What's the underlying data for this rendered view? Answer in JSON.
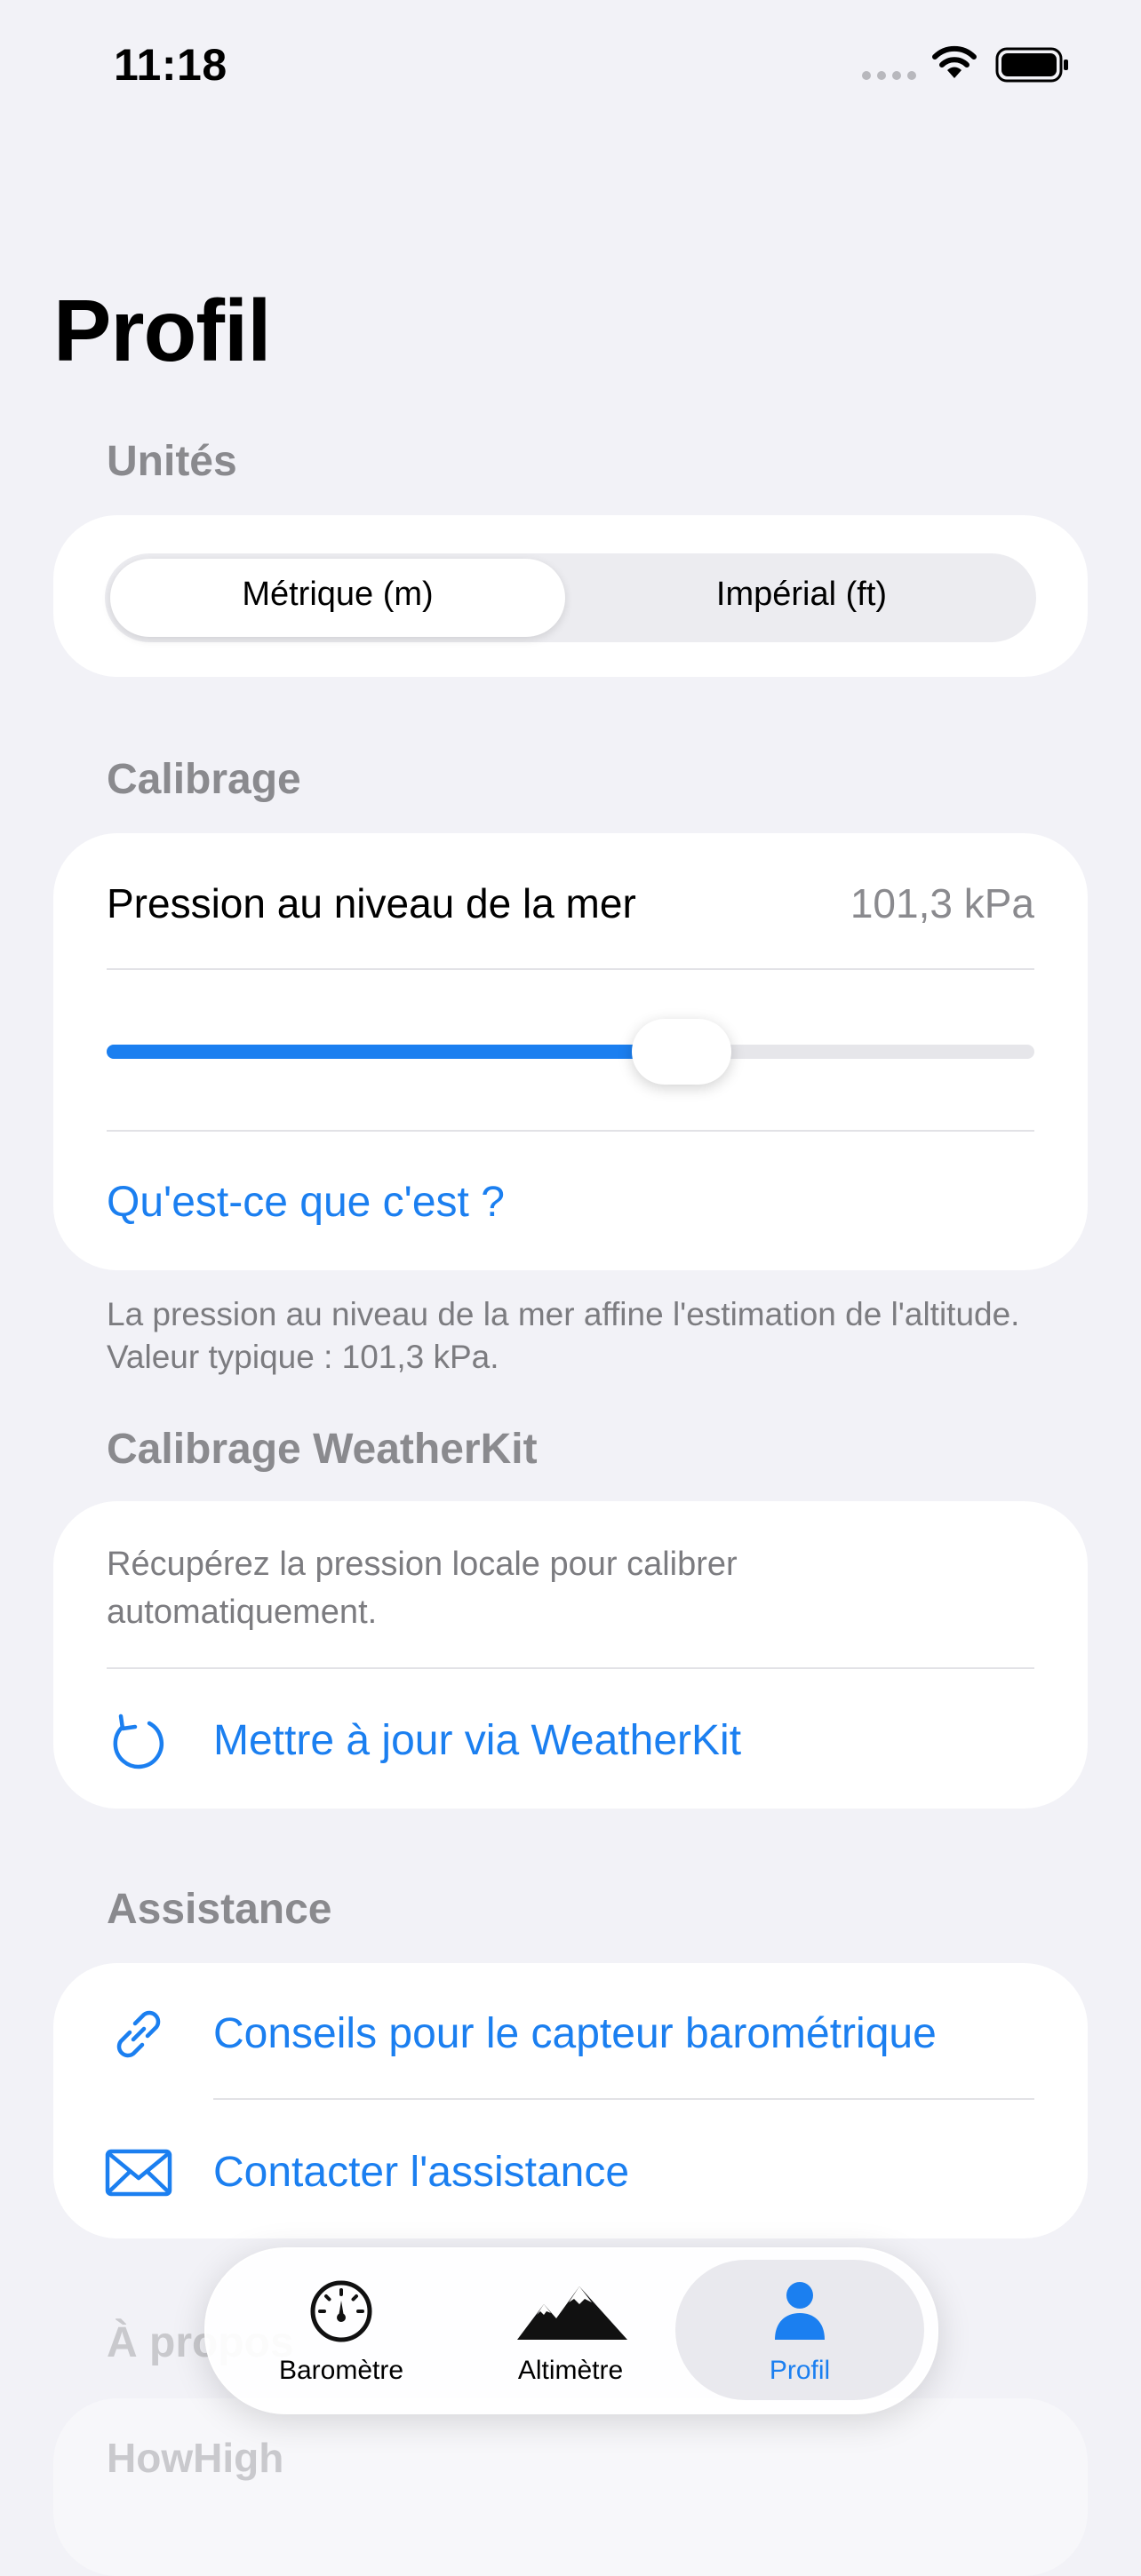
{
  "status_bar": {
    "time": "11:18"
  },
  "page_title": "Profil",
  "units": {
    "header": "Unités",
    "options": [
      "Métrique (m)",
      "Impérial (ft)"
    ],
    "selected": "Métrique (m)"
  },
  "calibration": {
    "header": "Calibrage",
    "pressure_label": "Pression au niveau de la mer",
    "pressure_value": "101,3 kPa",
    "slider_fraction": 0.62,
    "info_link": "Qu'est-ce que c'est ?",
    "footnote": "La pression au niveau de la mer affine l'estimation de l'altitude. Valeur typique : 101,3 kPa."
  },
  "weatherkit": {
    "header": "Calibrage WeatherKit",
    "description": "Récupérez la pression locale pour calibrer automatiquement.",
    "update_button": "Mettre à jour via WeatherKit"
  },
  "support": {
    "header": "Assistance",
    "items": [
      "Conseils pour le capteur barométrique",
      "Contacter l'assistance"
    ]
  },
  "about": {
    "header": "À propos",
    "app_name": "HowHigh"
  },
  "tab_bar": {
    "tabs": [
      "Baromètre",
      "Altimètre",
      "Profil"
    ],
    "selected": "Profil"
  },
  "colors": {
    "accent": "#1b7ff0",
    "background": "#f2f2f7"
  }
}
